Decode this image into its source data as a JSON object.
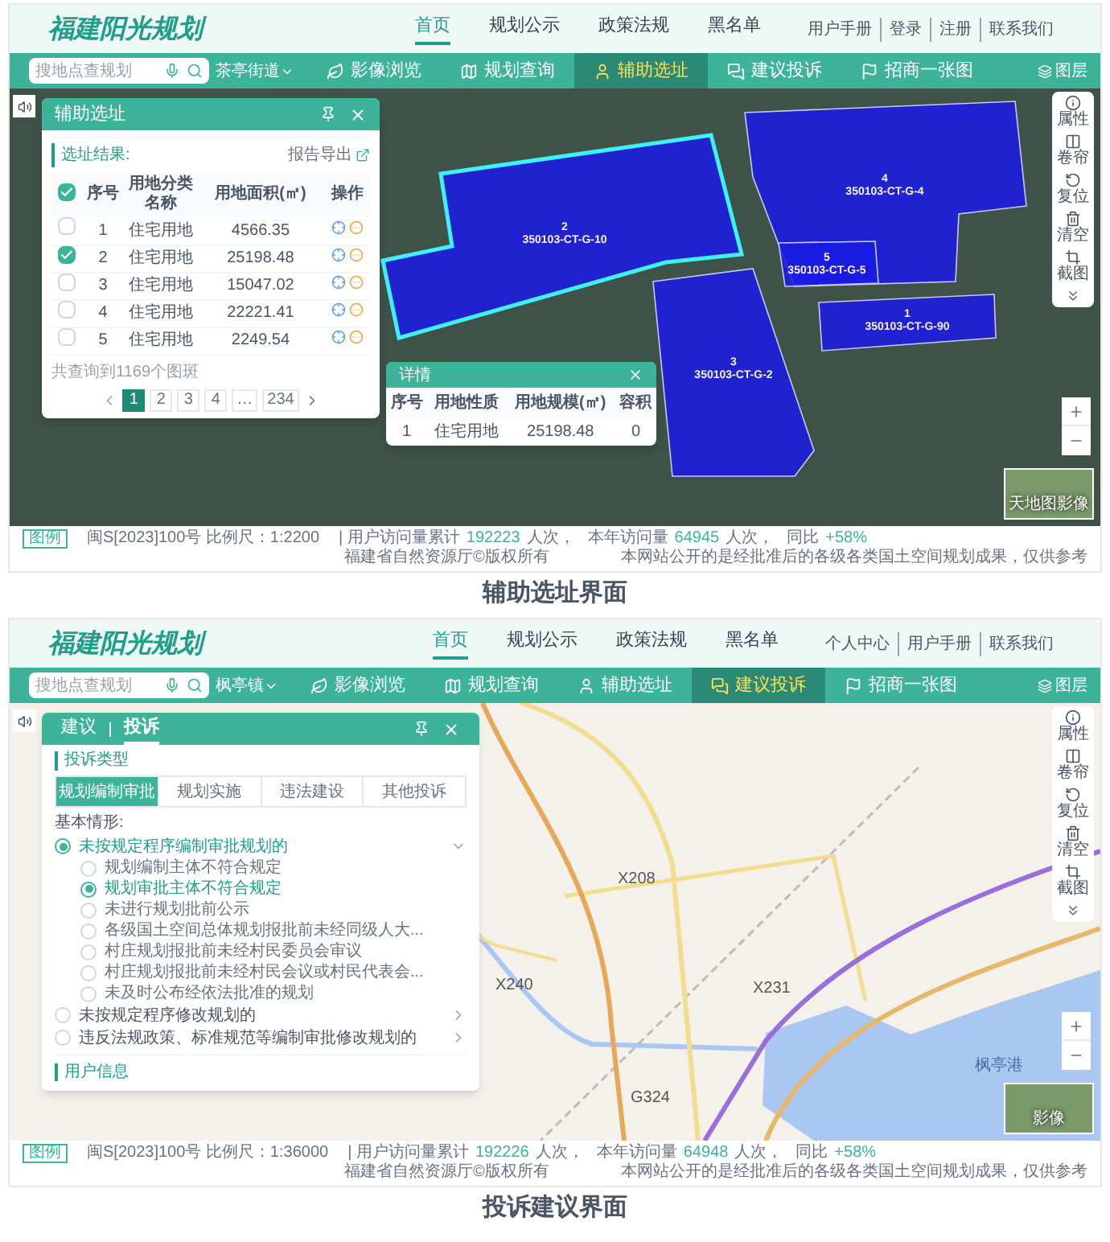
{
  "screens": [
    {
      "header": {
        "logo": "福建阳光规划",
        "nav": [
          {
            "label": "首页",
            "selected": true
          },
          {
            "label": "规划公示",
            "selected": false
          },
          {
            "label": "政策法规",
            "selected": false
          },
          {
            "label": "黑名单",
            "selected": false
          }
        ],
        "user_links": [
          "用户手册",
          "登录",
          "注册",
          "联系我们"
        ]
      },
      "toolbar": {
        "search": {
          "placeholder": "搜地点查规划"
        },
        "region": "茶亭街道",
        "tabs": [
          {
            "label": "影像浏览",
            "selected": false
          },
          {
            "label": "规划查询",
            "selected": false
          },
          {
            "label": "辅助选址",
            "selected": true
          },
          {
            "label": "建议投诉",
            "selected": false
          },
          {
            "label": "招商一张图",
            "selected": false
          }
        ],
        "layers": "图层"
      },
      "map": {
        "kind": "satellite",
        "parcels": [
          {
            "number": "2",
            "code": "350103-CT-G-10",
            "selected": true
          },
          {
            "number": "4",
            "code": "350103-CT-G-4",
            "selected": false
          },
          {
            "number": "5",
            "code": "350103-CT-G-5",
            "selected": false
          },
          {
            "number": "1",
            "code": "350103-CT-G-90",
            "selected": false
          },
          {
            "number": "3",
            "code": "350103-CT-G-2",
            "selected": false
          }
        ],
        "tools": [
          "属性",
          "卷帘",
          "复位",
          "清空",
          "截图"
        ],
        "basemap": "天地图影像"
      },
      "panel": {
        "kind": "site",
        "title": "辅助选址",
        "section": "选址结果:",
        "export": "报告导出",
        "header_checked": true,
        "columns": [
          "序号",
          "用地分类名称",
          "用地面积(㎡)",
          "操作"
        ],
        "rows": [
          {
            "checked": false,
            "index": "1",
            "category": "住宅用地",
            "area": "4566.35"
          },
          {
            "checked": true,
            "index": "2",
            "category": "住宅用地",
            "area": "25198.48"
          },
          {
            "checked": false,
            "index": "3",
            "category": "住宅用地",
            "area": "15047.02"
          },
          {
            "checked": false,
            "index": "4",
            "category": "住宅用地",
            "area": "22221.41"
          },
          {
            "checked": false,
            "index": "5",
            "category": "住宅用地",
            "area": "2249.54"
          }
        ],
        "total": "共查询到1169个图斑",
        "pages": [
          {
            "label": "1",
            "selected": true
          },
          {
            "label": "2",
            "selected": false
          },
          {
            "label": "3",
            "selected": false
          },
          {
            "label": "4",
            "selected": false
          },
          {
            "label": "…",
            "selected": false
          },
          {
            "label": "234",
            "selected": false
          }
        ]
      },
      "detail": {
        "title": "详情",
        "columns": [
          "序号",
          "用地性质",
          "用地规模(㎡)",
          "容积"
        ],
        "rows": [
          [
            "1",
            "住宅用地",
            "25198.48",
            "0"
          ]
        ]
      },
      "status": {
        "legend": "图例",
        "approval": "闽S[2023]100号 比例尺：1:2200",
        "total_label": "| 用户访问量累计",
        "total": "192223",
        "total_unit": "人次，",
        "year_label": "本年访问量",
        "year": "64945",
        "year_unit": "人次，",
        "yoy_label": "同比",
        "yoy": "+58%",
        "copyright": "福建省自然资源厅©版权所有",
        "notice": "本网站公开的是经批准后的各级各类国土空间规划成果，仅供参考"
      },
      "caption": "辅助选址界面"
    },
    {
      "header": {
        "logo": "福建阳光规划",
        "nav": [
          {
            "label": "首页",
            "selected": true
          },
          {
            "label": "规划公示",
            "selected": false
          },
          {
            "label": "政策法规",
            "selected": false
          },
          {
            "label": "黑名单",
            "selected": false
          }
        ],
        "user_links": [
          "个人中心",
          "用户手册",
          "联系我们"
        ]
      },
      "toolbar": {
        "search": {
          "placeholder": "搜地点查规划"
        },
        "region": "枫亭镇",
        "tabs": [
          {
            "label": "影像浏览",
            "selected": false
          },
          {
            "label": "规划查询",
            "selected": false
          },
          {
            "label": "辅助选址",
            "selected": false
          },
          {
            "label": "建议投诉",
            "selected": true
          },
          {
            "label": "招商一张图",
            "selected": false
          }
        ],
        "layers": "图层"
      },
      "map": {
        "kind": "street",
        "labels": [
          "X208",
          "X240",
          "X231",
          "G324",
          "枫亭港"
        ],
        "tools": [
          "属性",
          "卷帘",
          "复位",
          "清空",
          "截图"
        ],
        "basemap": "影像"
      },
      "panel": {
        "kind": "complaint",
        "tabs": [
          {
            "label": "建议",
            "selected": false
          },
          {
            "label": "投诉",
            "selected": true
          }
        ],
        "section": "投诉类型",
        "types": [
          {
            "label": "规划编制审批",
            "selected": true
          },
          {
            "label": "规划实施",
            "selected": false
          },
          {
            "label": "违法建设",
            "selected": false
          },
          {
            "label": "其他投诉",
            "selected": false
          }
        ],
        "situation_label": "基本情形:",
        "situations": [
          {
            "label": "未按规定程序编制审批规划的",
            "selected": true,
            "expanded": true,
            "children": [
              {
                "label": "规划编制主体不符合规定",
                "selected": false
              },
              {
                "label": "规划审批主体不符合规定",
                "selected": true
              },
              {
                "label": "未进行规划批前公示",
                "selected": false
              },
              {
                "label": "各级国土空间总体规划报批前未经同级人大...",
                "selected": false
              },
              {
                "label": "村庄规划报批前未经村民委员会审议",
                "selected": false
              },
              {
                "label": "村庄规划报批前未经村民会议或村民代表会...",
                "selected": false
              },
              {
                "label": "未及时公布经依法批准的规划",
                "selected": false
              }
            ]
          },
          {
            "label": "未按规定程序修改规划的",
            "selected": false,
            "expanded": false
          },
          {
            "label": "违反法规政策、标准规范等编制审批修改规划的",
            "selected": false,
            "expanded": false
          }
        ],
        "user_section": "用户信息"
      },
      "status": {
        "legend": "图例",
        "approval": "闽S[2023]100号 比例尺：1:36000",
        "total_label": "| 用户访问量累计",
        "total": "192226",
        "total_unit": "人次，",
        "year_label": "本年访问量",
        "year": "64948",
        "year_unit": "人次，",
        "yoy_label": "同比",
        "yoy": "+58%",
        "copyright": "福建省自然资源厅©版权所有",
        "notice": "本网站公开的是经批准后的各级各类国土空间规划成果，仅供参考"
      },
      "caption": "投诉建议界面"
    }
  ]
}
